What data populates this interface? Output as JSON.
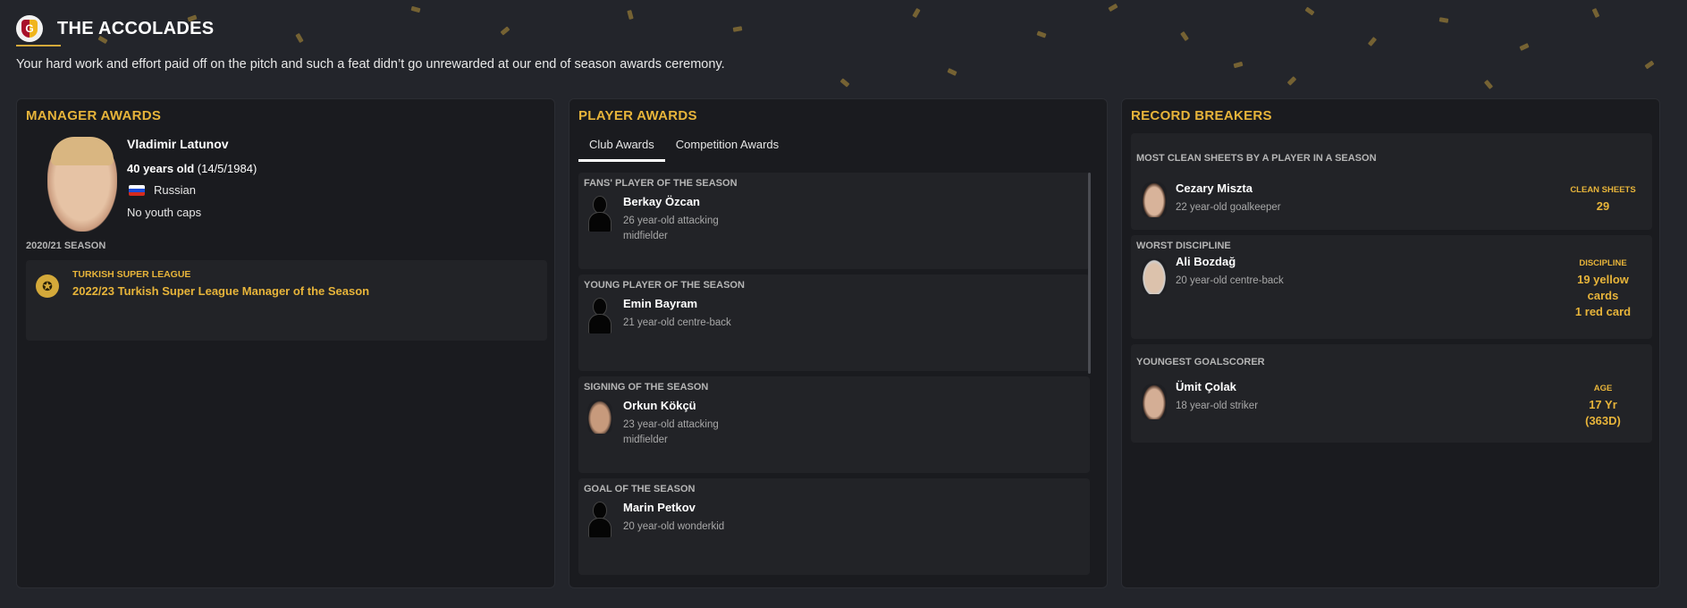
{
  "header": {
    "title": "THE ACCOLADES",
    "subtitle": "Your hard work and effort paid off on the pitch and such a feat didn’t go unrewarded at our end of season awards ceremony.",
    "crest_letter": "G"
  },
  "manager": {
    "panel_title": "MANAGER AWARDS",
    "name": "Vladimir Latunov",
    "age": "40 years old",
    "dob": "(14/5/1984)",
    "nationality": "Russian",
    "caps": "No youth caps",
    "season": "2020/21 SEASON",
    "award": {
      "competition": "TURKISH SUPER LEAGUE",
      "name": "2022/23 Turkish Super League Manager of the Season"
    }
  },
  "players": {
    "panel_title": "PLAYER AWARDS",
    "tabs": [
      "Club Awards",
      "Competition Awards"
    ],
    "awards": [
      {
        "label": "FANS' PLAYER OF THE SEASON",
        "name": "Berkay Özcan",
        "desc": "26 year-old attacking midfielder"
      },
      {
        "label": "YOUNG PLAYER OF THE SEASON",
        "name": "Emin Bayram",
        "desc": "21 year-old centre-back"
      },
      {
        "label": "SIGNING OF THE SEASON",
        "name": "Orkun Kökçü",
        "desc": "23 year-old attacking midfielder"
      },
      {
        "label": "GOAL OF THE SEASON",
        "name": "Marin Petkov",
        "desc": "20 year-old wonderkid"
      }
    ]
  },
  "records": {
    "panel_title": "RECORD BREAKERS",
    "items": [
      {
        "label": "MOST CLEAN SHEETS BY A PLAYER IN A SEASON",
        "name": "Cezary Miszta",
        "desc": "22 year-old goalkeeper",
        "stat_label": "CLEAN SHEETS",
        "stat_value": "29"
      },
      {
        "label": "WORST DISCIPLINE",
        "name": "Ali Bozdağ",
        "desc": "20 year-old centre-back",
        "stat_label": "DISCIPLINE",
        "stat_value_1": "19 yellow",
        "stat_value_2": "cards",
        "stat_value_3": "1 red card"
      },
      {
        "label": "YOUNGEST GOALSCORER",
        "name": "Ümit Çolak",
        "desc": "18 year-old striker",
        "stat_label": "AGE",
        "stat_value_1": "17 Yr",
        "stat_value_2": "(363D)"
      }
    ]
  },
  "colors": {
    "accent": "#e7b43a",
    "background": "#23252b",
    "panel": "#1a1b1f",
    "card": "#222327"
  },
  "icons": {
    "crest": "club-crest-icon",
    "medal": "award-medal-icon",
    "flag": "russia-flag-icon"
  }
}
